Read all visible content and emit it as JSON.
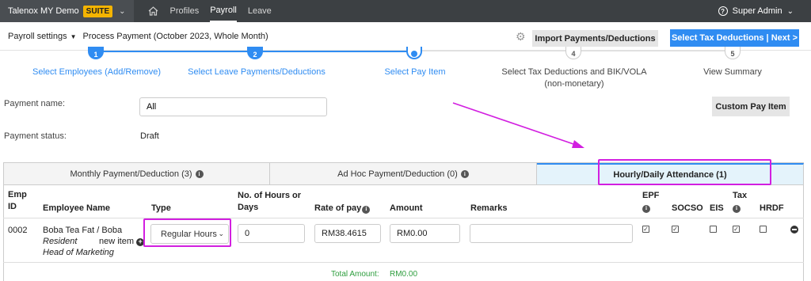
{
  "topnav": {
    "company": "Talenox MY Demo",
    "badge": "SUITE",
    "links": [
      "Profiles",
      "Payroll",
      "Leave"
    ],
    "user": "Super Admin"
  },
  "subheader": {
    "settings": "Payroll settings",
    "process": "Process Payment (October 2023, Whole Month)",
    "import_button": "Import Payments/Deductions",
    "next_button": "Select Tax Deductions | Next >"
  },
  "steps": [
    {
      "num": "1",
      "label": "Select Employees (Add/Remove)"
    },
    {
      "num": "2",
      "label": "Select Leave Payments/Deductions"
    },
    {
      "num": "3",
      "label": "Select Pay Item"
    },
    {
      "num": "4",
      "label": "Select Tax Deductions and BIK/VOLA (non-monetary)"
    },
    {
      "num": "5",
      "label": "View Summary"
    }
  ],
  "form": {
    "payment_name_label": "Payment name:",
    "payment_name_value": "All",
    "payment_status_label": "Payment status:",
    "payment_status_value": "Draft",
    "custom_button": "Custom Pay Item"
  },
  "tabs": [
    {
      "label": "Monthly Payment/Deduction (3)"
    },
    {
      "label": "Ad Hoc Payment/Deduction (0)"
    },
    {
      "label": "Hourly/Daily Attendance (1)"
    }
  ],
  "table": {
    "headers": {
      "emp_id": [
        "Emp",
        "ID"
      ],
      "name": "Employee Name",
      "type": "Type",
      "hours": [
        "No. of Hours or",
        "Days"
      ],
      "rate": "Rate of pay",
      "amount": "Amount",
      "remarks": "Remarks",
      "epf": "EPF",
      "socso": "SOCSO",
      "eis": "EIS",
      "tax": "Tax",
      "hrdf": "HRDF"
    },
    "row": {
      "emp_id": "0002",
      "name": "Boba Tea Fat / Boba",
      "resident": "Resident",
      "new_item": "new item",
      "role": "Head of Marketing",
      "type": "Regular Hours",
      "hours": "0",
      "rate": "RM38.4615",
      "amount": "RM0.00",
      "remarks": "",
      "checks": {
        "epf": "true",
        "socso": "true",
        "eis": "false",
        "tax": "true",
        "hrdf": "false"
      }
    },
    "total_label": "Total Amount:",
    "total_value": "RM0.00"
  },
  "colors": {
    "accent": "#2f8cf2",
    "highlight": "#d21fe0",
    "total": "#2e9e3e"
  }
}
